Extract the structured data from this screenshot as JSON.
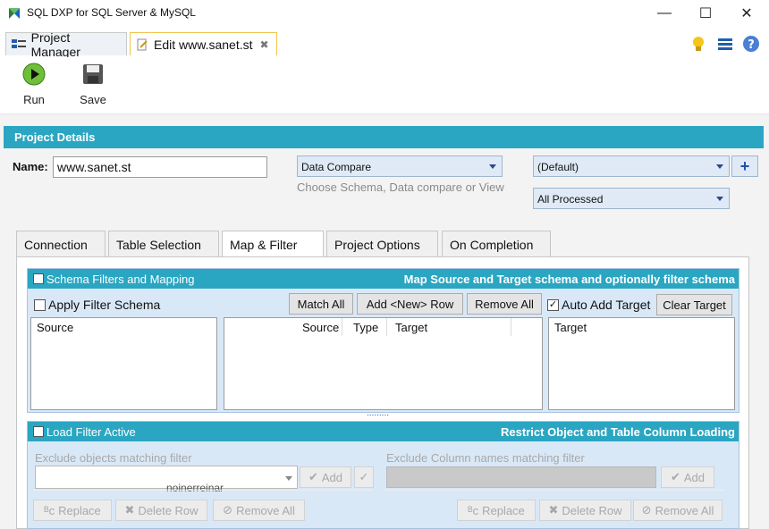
{
  "window": {
    "title": "SQL DXP for SQL Server & MySQL",
    "minimize": "—",
    "maximize": "☐",
    "close": "✕"
  },
  "doc_tabs": [
    {
      "label": "Project Manager"
    },
    {
      "label": "Edit www.sanet.st",
      "close": "✖"
    }
  ],
  "toolbar": {
    "run_label": "Run",
    "save_label": "Save"
  },
  "project_details": {
    "header": "Project Details",
    "name_label": "Name:",
    "name_value": "www.sanet.st",
    "compare_type": "Data Compare",
    "compare_hint": "Choose Schema, Data compare or View",
    "schema_select": "(Default)",
    "processed_select": "All Processed",
    "add_symbol": "+"
  },
  "tabs": [
    {
      "label": "Connection"
    },
    {
      "label": "Table Selection"
    },
    {
      "label": "Map & Filter"
    },
    {
      "label": "Project Options"
    },
    {
      "label": "On Completion"
    }
  ],
  "schema_filters": {
    "title": "Schema Filters and Mapping",
    "description": "Map Source and Target schema and optionally filter schema",
    "apply_filter_label": "Apply Filter Schema",
    "match_all": "Match All",
    "add_new_row": "Add <New> Row",
    "remove_all": "Remove All",
    "auto_add_target_label": "Auto Add Target",
    "auto_add_target_checked": true,
    "clear_target": "Clear Target",
    "source_list_header": "Source",
    "mapping_columns": [
      "Source",
      "Type",
      "Target"
    ],
    "target_list_header": "Target",
    "splitter": "........."
  },
  "load_filter": {
    "title": "Load Filter Active",
    "description": "Restrict Object and Table Column Loading",
    "exclude_objects_label": "Exclude objects matching filter",
    "exclude_columns_label": "Exclude Column names matching filter",
    "add_label": "Add",
    "replace_label": "Replace",
    "delete_row_label": "Delete Row",
    "remove_all_label": "Remove All",
    "overlay_text": "noinerreinar"
  },
  "colors": {
    "accent": "#2aa6c2",
    "group_bg": "#d9e8f7",
    "combo_bg": "#dfeaf6"
  }
}
